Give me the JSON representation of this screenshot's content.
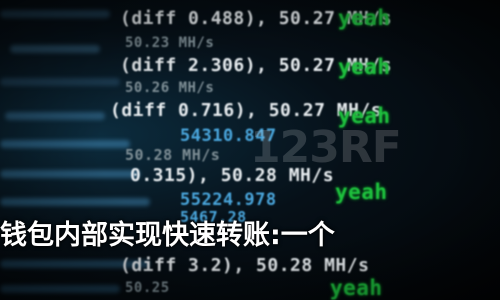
{
  "lines": [
    {
      "text": "(diff 0.488), 50.27 MH/s",
      "badge": "yeah"
    },
    {
      "text": "50.23 MH/s"
    },
    {
      "text": "(diff 2.306), 50.27 MH/s",
      "badge": "yeah"
    },
    {
      "text": "50.26 MH/s"
    },
    {
      "text": "(diff 0.716), 50.27 MH/s",
      "badge": "yeah"
    },
    {
      "text": "54310.847"
    },
    {
      "text": "50.28 MH/s"
    },
    {
      "text": "0.315), 50.28 MH/s",
      "badge": "yeah"
    },
    {
      "text": "55224.978"
    },
    {
      "text": "5467.28"
    },
    {
      "text": "(diff 3.2), 50.28 MH/s",
      "badge": "yeah"
    },
    {
      "text": "50.25"
    }
  ],
  "watermark": "123RF",
  "caption": "钱包内部实现快速转账:一个"
}
